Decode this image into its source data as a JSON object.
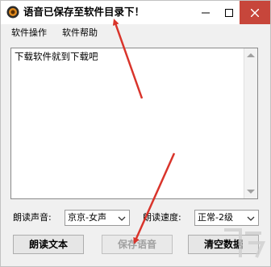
{
  "window": {
    "title": "语音已保存至软件目录下！"
  },
  "menu": {
    "items": [
      "软件操作",
      "软件帮助"
    ]
  },
  "editor": {
    "text": "下载软件就到下载吧"
  },
  "voice": {
    "label": "朗读声音:",
    "value": "京京-女声"
  },
  "speed": {
    "label": "朗读速度:",
    "value": "正常-2级"
  },
  "buttons": {
    "read": "朗读文本",
    "save": "保存语音",
    "clear": "清空数据"
  },
  "colors": {
    "close_button": "#c7463b",
    "annotation_arrow": "#d9342b"
  }
}
